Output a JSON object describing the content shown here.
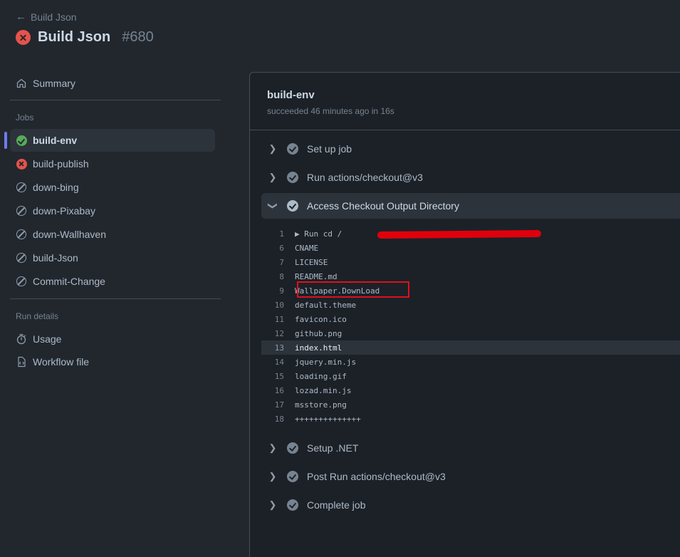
{
  "header": {
    "back_label": "Build Json",
    "title": "Build Json",
    "run_number": "#680"
  },
  "sidebar": {
    "summary_label": "Summary",
    "jobs_heading": "Jobs",
    "jobs": [
      {
        "label": "build-env",
        "status": "success"
      },
      {
        "label": "build-publish",
        "status": "failure"
      },
      {
        "label": "down-bing",
        "status": "skipped"
      },
      {
        "label": "down-Pixabay",
        "status": "skipped"
      },
      {
        "label": "down-Wallhaven",
        "status": "skipped"
      },
      {
        "label": "build-Json",
        "status": "skipped"
      },
      {
        "label": "Commit-Change",
        "status": "skipped"
      }
    ],
    "run_details_heading": "Run details",
    "usage_label": "Usage",
    "workflow_file_label": "Workflow file"
  },
  "job": {
    "title": "build-env",
    "subtitle": "succeeded 46 minutes ago in 16s"
  },
  "steps_before": [
    {
      "label": "Set up job"
    },
    {
      "label": "Run actions/checkout@v3"
    }
  ],
  "expanded_step": {
    "label": "Access Checkout Output Directory"
  },
  "log": [
    {
      "n": "1",
      "text": "▶ Run cd /"
    },
    {
      "n": "6",
      "text": "CNAME"
    },
    {
      "n": "7",
      "text": "LICENSE"
    },
    {
      "n": "8",
      "text": "README.md"
    },
    {
      "n": "9",
      "text": "Wallpaper.DownLoad"
    },
    {
      "n": "10",
      "text": "default.theme"
    },
    {
      "n": "11",
      "text": "favicon.ico"
    },
    {
      "n": "12",
      "text": "github.png"
    },
    {
      "n": "13",
      "text": "index.html"
    },
    {
      "n": "14",
      "text": "jquery.min.js"
    },
    {
      "n": "15",
      "text": "loading.gif"
    },
    {
      "n": "16",
      "text": "lozad.min.js"
    },
    {
      "n": "17",
      "text": "msstore.png"
    },
    {
      "n": "18",
      "text": "++++++++++++++"
    }
  ],
  "steps_after": [
    {
      "label": "Setup .NET"
    },
    {
      "label": "Post Run actions/checkout@v3"
    },
    {
      "label": "Complete job"
    }
  ],
  "colors": {
    "accent": "#6c7cf0",
    "success": "#57ab5a",
    "failure": "#e5534b",
    "annotation_red": "#e0101a"
  }
}
